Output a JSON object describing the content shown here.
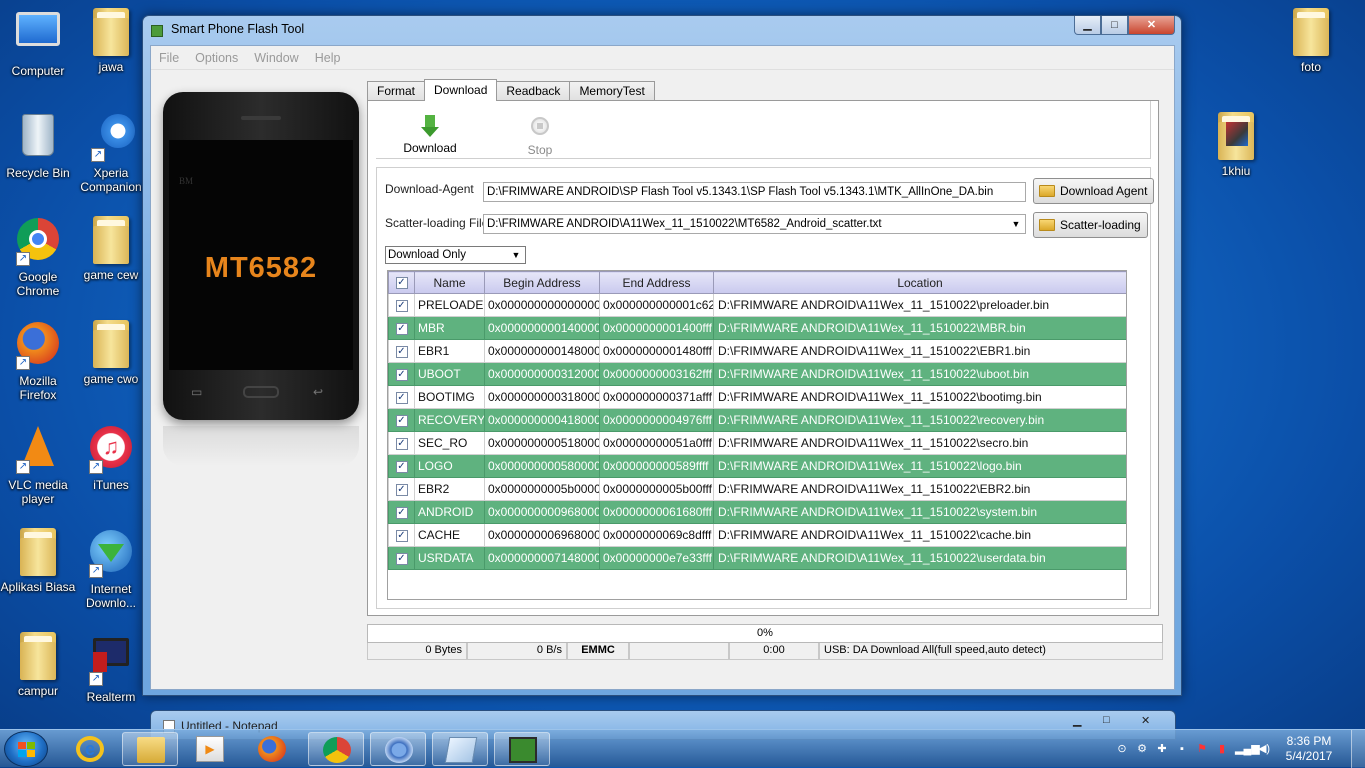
{
  "desktop": {
    "left_icons": [
      {
        "label": "Computer"
      },
      {
        "label": "jawa"
      },
      {
        "label": "Recycle Bin"
      },
      {
        "label": "Xperia Companion"
      },
      {
        "label": "Google Chrome"
      },
      {
        "label": "game cew"
      },
      {
        "label": "Mozilla Firefox"
      },
      {
        "label": "game cwo"
      },
      {
        "label": "VLC media player"
      },
      {
        "label": "iTunes"
      },
      {
        "label": "Aplikasi Biasa"
      },
      {
        "label": "Internet Downlo..."
      },
      {
        "label": "campur"
      },
      {
        "label": "Realterm"
      }
    ],
    "right_icons": [
      {
        "label": "foto"
      },
      {
        "label": "1khiu"
      }
    ]
  },
  "window": {
    "title": "Smart Phone Flash Tool",
    "menu": [
      "File",
      "Options",
      "Window",
      "Help"
    ],
    "phone_model": "MT6582",
    "phone_brand": "BM",
    "tabs": [
      "Format",
      "Download",
      "Readback",
      "MemoryTest"
    ],
    "active_tab": "Download",
    "toolbar": {
      "download_label": "Download",
      "stop_label": "Stop"
    },
    "download_agent": {
      "label": "Download-Agent",
      "value": "D:\\FRIMWARE ANDROID\\SP Flash Tool v5.1343.1\\SP Flash Tool v5.1343.1\\MTK_AllInOne_DA.bin",
      "button": "Download Agent"
    },
    "scatter": {
      "label": "Scatter-loading File",
      "value": "D:\\FRIMWARE ANDROID\\A11Wex_11_1510022\\MT6582_Android_scatter.txt",
      "button": "Scatter-loading"
    },
    "mode": "Download Only",
    "table": {
      "headers": [
        "Name",
        "Begin Address",
        "End Address",
        "Location"
      ],
      "rows": [
        {
          "name": "PRELOADER",
          "begin": "0x0000000000000000",
          "end": "0x000000000001c623",
          "location": "D:\\FRIMWARE ANDROID\\A11Wex_11_1510022\\preloader.bin"
        },
        {
          "name": "MBR",
          "begin": "0x0000000001400000",
          "end": "0x0000000001400fff",
          "location": "D:\\FRIMWARE ANDROID\\A11Wex_11_1510022\\MBR.bin"
        },
        {
          "name": "EBR1",
          "begin": "0x0000000001480000",
          "end": "0x0000000001480fff",
          "location": "D:\\FRIMWARE ANDROID\\A11Wex_11_1510022\\EBR1.bin"
        },
        {
          "name": "UBOOT",
          "begin": "0x0000000003120000",
          "end": "0x0000000003162fff",
          "location": "D:\\FRIMWARE ANDROID\\A11Wex_11_1510022\\uboot.bin"
        },
        {
          "name": "BOOTIMG",
          "begin": "0x0000000003180000",
          "end": "0x000000000371afff",
          "location": "D:\\FRIMWARE ANDROID\\A11Wex_11_1510022\\bootimg.bin"
        },
        {
          "name": "RECOVERY",
          "begin": "0x0000000004180000",
          "end": "0x0000000004976fff",
          "location": "D:\\FRIMWARE ANDROID\\A11Wex_11_1510022\\recovery.bin"
        },
        {
          "name": "SEC_RO",
          "begin": "0x0000000005180000",
          "end": "0x00000000051a0fff",
          "location": "D:\\FRIMWARE ANDROID\\A11Wex_11_1510022\\secro.bin"
        },
        {
          "name": "LOGO",
          "begin": "0x0000000005800000",
          "end": "0x000000000589ffff",
          "location": "D:\\FRIMWARE ANDROID\\A11Wex_11_1510022\\logo.bin"
        },
        {
          "name": "EBR2",
          "begin": "0x0000000005b00000",
          "end": "0x0000000005b00fff",
          "location": "D:\\FRIMWARE ANDROID\\A11Wex_11_1510022\\EBR2.bin"
        },
        {
          "name": "ANDROID",
          "begin": "0x0000000009680000",
          "end": "0x0000000061680fff",
          "location": "D:\\FRIMWARE ANDROID\\A11Wex_11_1510022\\system.bin"
        },
        {
          "name": "CACHE",
          "begin": "0x0000000069680000",
          "end": "0x0000000069c8dfff",
          "location": "D:\\FRIMWARE ANDROID\\A11Wex_11_1510022\\cache.bin"
        },
        {
          "name": "USRDATA",
          "begin": "0x0000000071480000",
          "end": "0x00000000e7e33fff",
          "location": "D:\\FRIMWARE ANDROID\\A11Wex_11_1510022\\userdata.bin"
        }
      ]
    },
    "progress": "0%",
    "status": {
      "bytes": "0 Bytes",
      "speed": "0 B/s",
      "storage": "EMMC",
      "time": "0:00",
      "usb": "USB: DA Download All(full speed,auto detect)"
    }
  },
  "notepad": {
    "title": "Untitled - Notepad"
  },
  "taskbar": {
    "clock_time": "8:36 PM",
    "clock_date": "5/4/2017"
  },
  "colors": {
    "row_green": "#5fb27f",
    "phone_model_text": "#e7851c",
    "header_lavender": "#c9c9ee"
  }
}
